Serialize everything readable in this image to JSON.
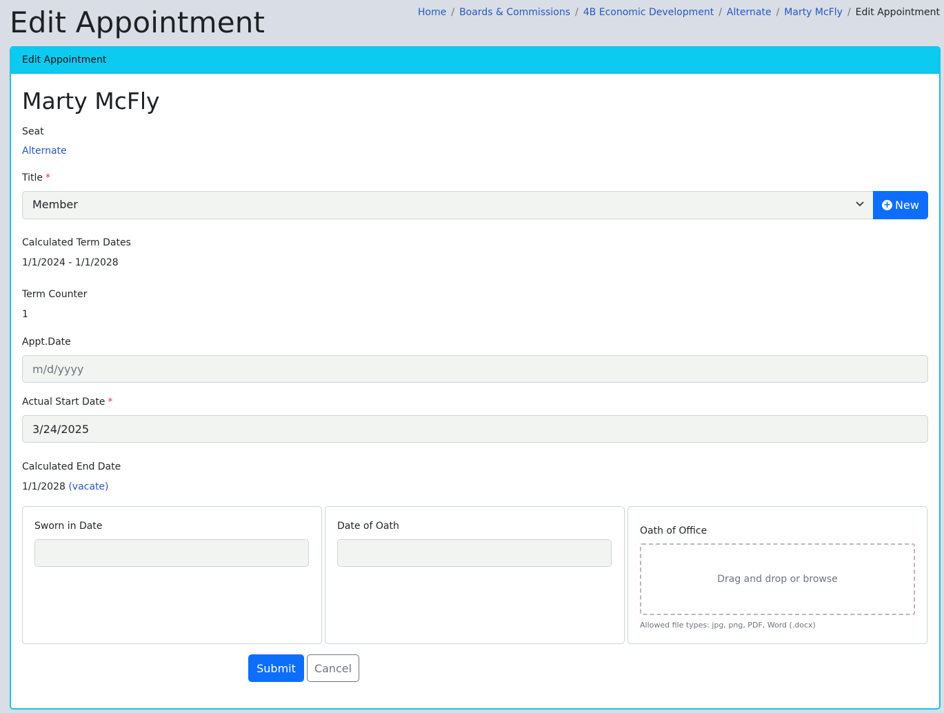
{
  "page": {
    "title": "Edit Appointment"
  },
  "breadcrumb": {
    "items": [
      "Home",
      "Boards & Commissions",
      "4B Economic Development",
      "Alternate",
      "Marty McFly"
    ],
    "separator": "/",
    "current": "Edit Appointment"
  },
  "card": {
    "header": "Edit Appointment"
  },
  "person": {
    "name": "Marty McFly"
  },
  "seat": {
    "label": "Seat",
    "value": "Alternate"
  },
  "title_field": {
    "label": "Title",
    "required_mark": "*",
    "value": "Member",
    "new_button": "New"
  },
  "calculated_term": {
    "label": "Calculated Term Dates",
    "value": "1/1/2024 - 1/1/2028"
  },
  "term_counter": {
    "label": "Term Counter",
    "value": "1"
  },
  "appt_date": {
    "label": "Appt.Date",
    "placeholder": "m/d/yyyy",
    "value": ""
  },
  "actual_start": {
    "label": "Actual Start Date",
    "required_mark": "*",
    "value": "3/24/2025"
  },
  "calculated_end": {
    "label": "Calculated End Date",
    "value": "1/1/2028",
    "vacate_link": "(vacate)"
  },
  "sworn_in": {
    "label": "Sworn in Date",
    "value": ""
  },
  "date_of_oath": {
    "label": "Date of Oath",
    "value": ""
  },
  "oath_of_office": {
    "label": "Oath of Office",
    "dropzone": "Drag and drop or browse",
    "hint": "Allowed file types: jpg, png, PDF, Word (.docx)"
  },
  "actions": {
    "submit": "Submit",
    "cancel": "Cancel"
  },
  "colors": {
    "primary": "#0d6efd",
    "header": "#0dcaf0",
    "required": "#dc3545",
    "link": "#2457c5"
  }
}
